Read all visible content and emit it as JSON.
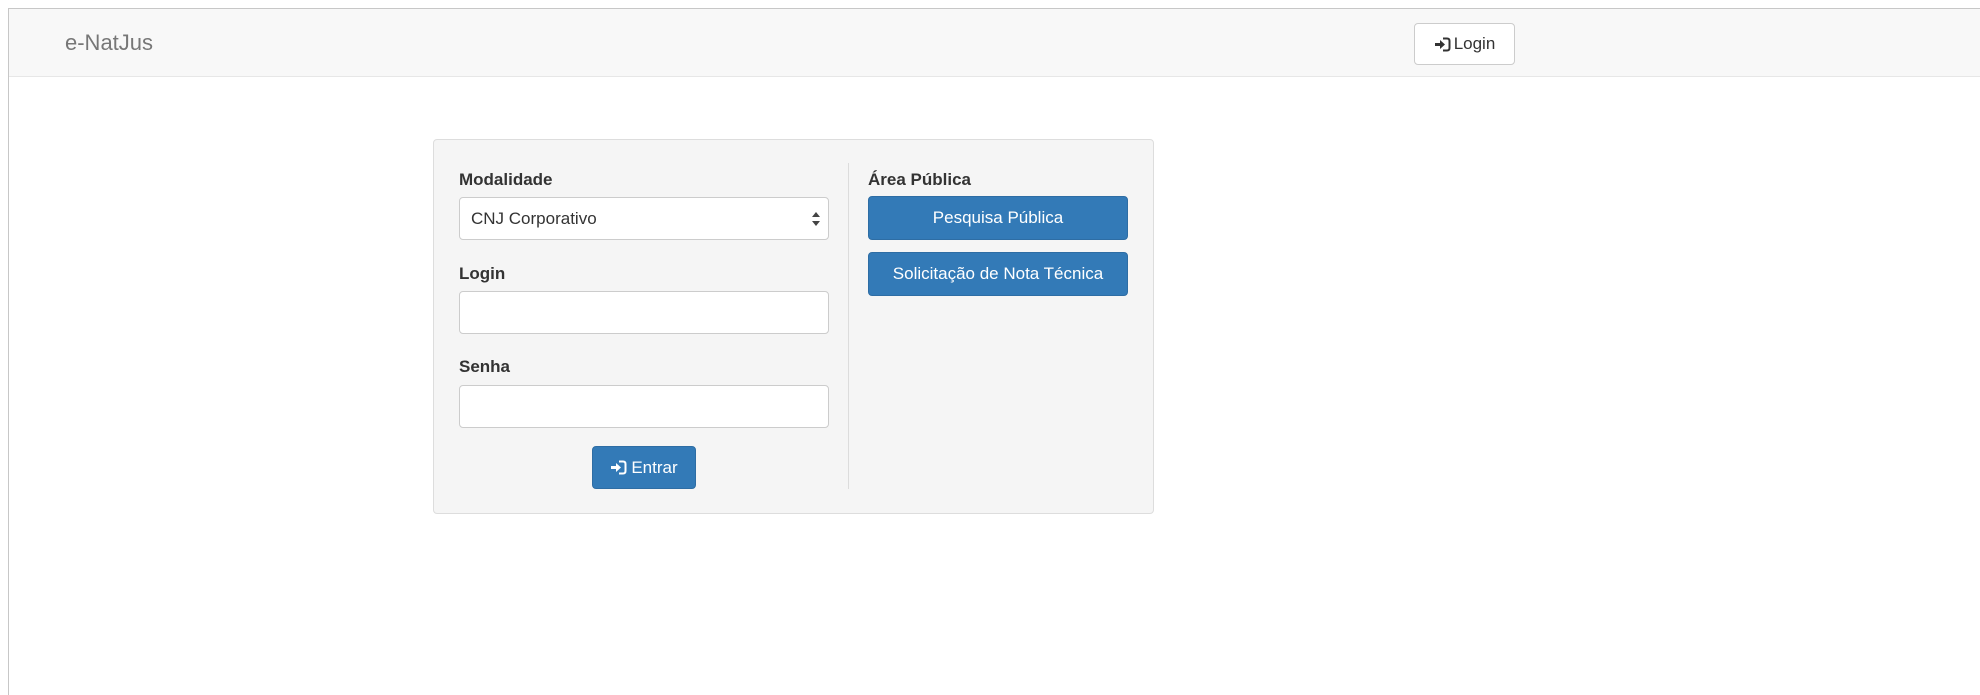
{
  "navbar": {
    "brand": "e-NatJus",
    "login_label": "Login"
  },
  "form": {
    "modalidade_label": "Modalidade",
    "modalidade_value": "CNJ Corporativo",
    "login_label": "Login",
    "login_value": "",
    "senha_label": "Senha",
    "senha_value": "",
    "submit_label": "Entrar"
  },
  "public_area": {
    "title": "Área Pública",
    "search_button": "Pesquisa Pública",
    "request_button": "Solicitação de Nota Técnica"
  },
  "icons": {
    "enter": "enter-icon",
    "select_arrows": "sort-arrows-icon"
  },
  "colors": {
    "primary": "#337ab7",
    "navbar_bg": "#f8f8f8",
    "panel_bg": "#f5f5f5"
  }
}
